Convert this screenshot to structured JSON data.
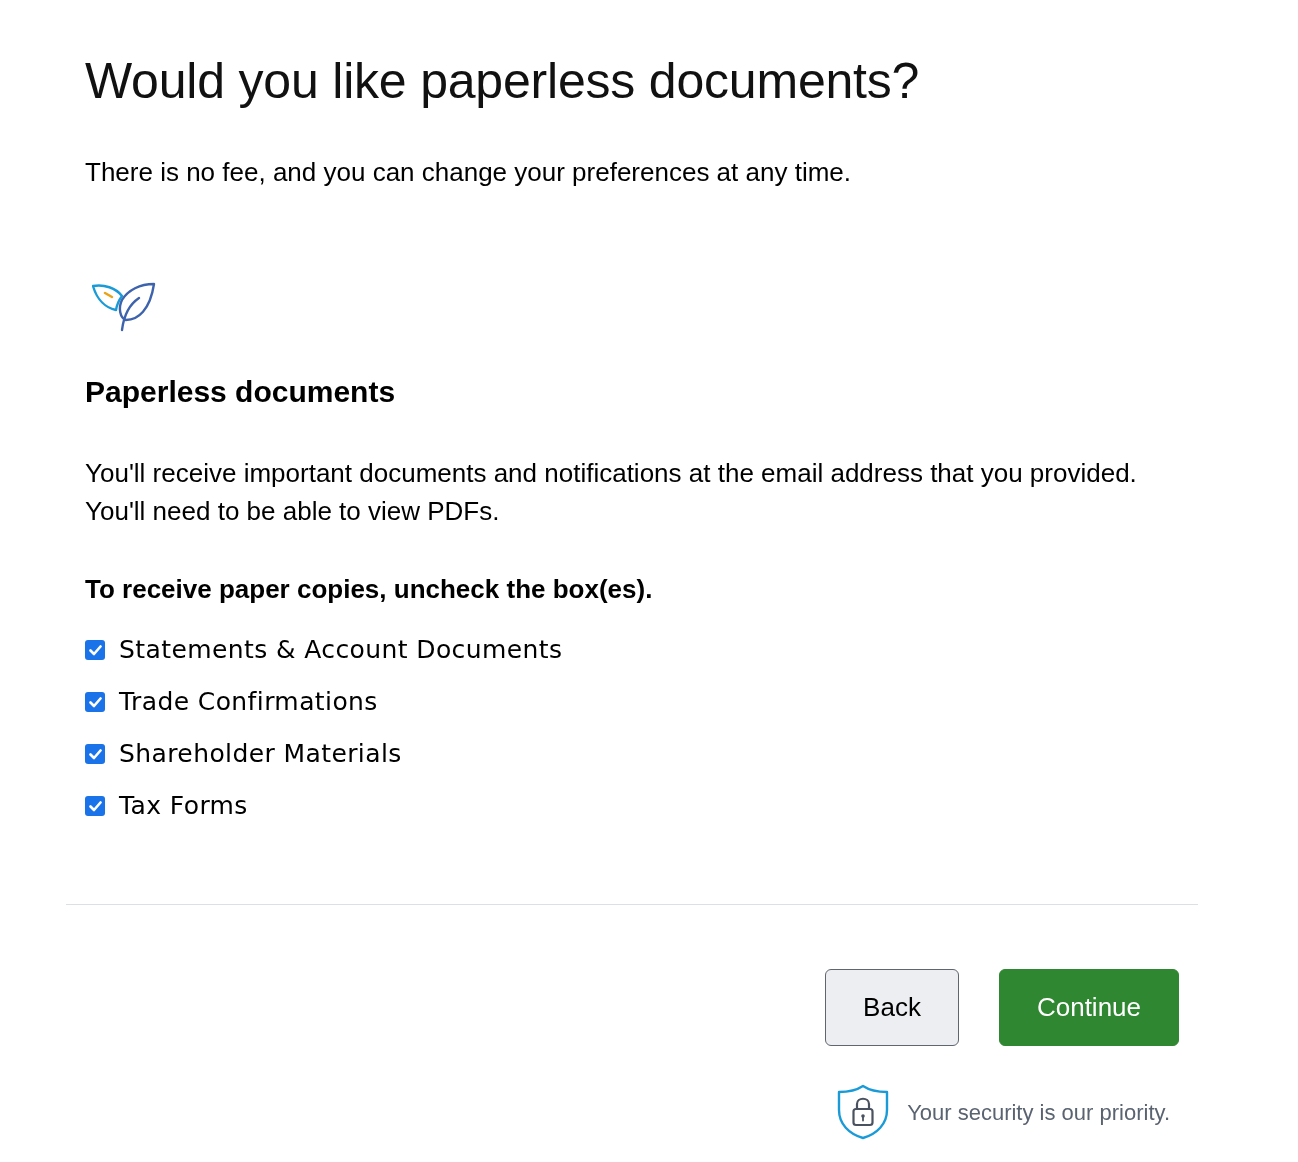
{
  "page": {
    "title": "Would you like paperless documents?",
    "subtitle": "There is no fee, and you can change your preferences at any time."
  },
  "section": {
    "heading": "Paperless documents",
    "description": "You'll receive important documents and notifications at the email address that you provided. You'll need to be able to view PDFs.",
    "instruction": "To receive paper copies, uncheck the box(es).",
    "options": [
      {
        "label": "Statements & Account Documents",
        "checked": true
      },
      {
        "label": "Trade Confirmations",
        "checked": true
      },
      {
        "label": "Shareholder Materials",
        "checked": true
      },
      {
        "label": "Tax Forms",
        "checked": true
      }
    ]
  },
  "actions": {
    "buttons": [
      {
        "label": "Back",
        "kind": "secondary"
      },
      {
        "label": "Continue",
        "kind": "primary"
      }
    ]
  },
  "footer": {
    "security_note": "Your security is our priority."
  }
}
